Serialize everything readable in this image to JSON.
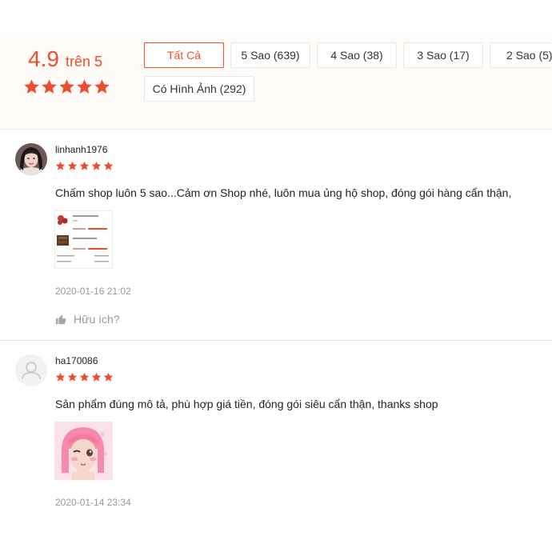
{
  "summary": {
    "score": "4.9",
    "score_suffix": "trên 5",
    "stars": 5,
    "filters": [
      {
        "label": "Tất Cả",
        "active": true
      },
      {
        "label": "5 Sao (639)",
        "active": false
      },
      {
        "label": "4 Sao (38)",
        "active": false
      },
      {
        "label": "3 Sao (17)",
        "active": false
      },
      {
        "label": "2 Sao (5)",
        "active": false
      },
      {
        "label": "Có Hình Ảnh (292)",
        "active": false
      }
    ]
  },
  "reviews": [
    {
      "username": "linhanh1976",
      "stars": 5,
      "comment": "Chấm shop luôn 5 sao...Cảm ơn Shop nhé, luôn mua ủng hộ shop, đóng gói hàng cẩn thận,",
      "time": "2020-01-16 21:02",
      "helpful_label": "Hữu ích?"
    },
    {
      "username": "ha170086",
      "stars": 5,
      "comment": "Sản phẩm đúng mô tả, phù hợp giá tiền, đóng gói siêu cẩn thận, thanks shop",
      "time": "2020-01-14 23:34"
    }
  ],
  "colors": {
    "accent": "#ee4d2d",
    "summary_bg": "#fffbf8",
    "muted_text": "#999999"
  },
  "icons": {
    "star": "star-icon",
    "like": "thumbs-up-icon",
    "default_avatar": "user-silhouette-icon"
  }
}
